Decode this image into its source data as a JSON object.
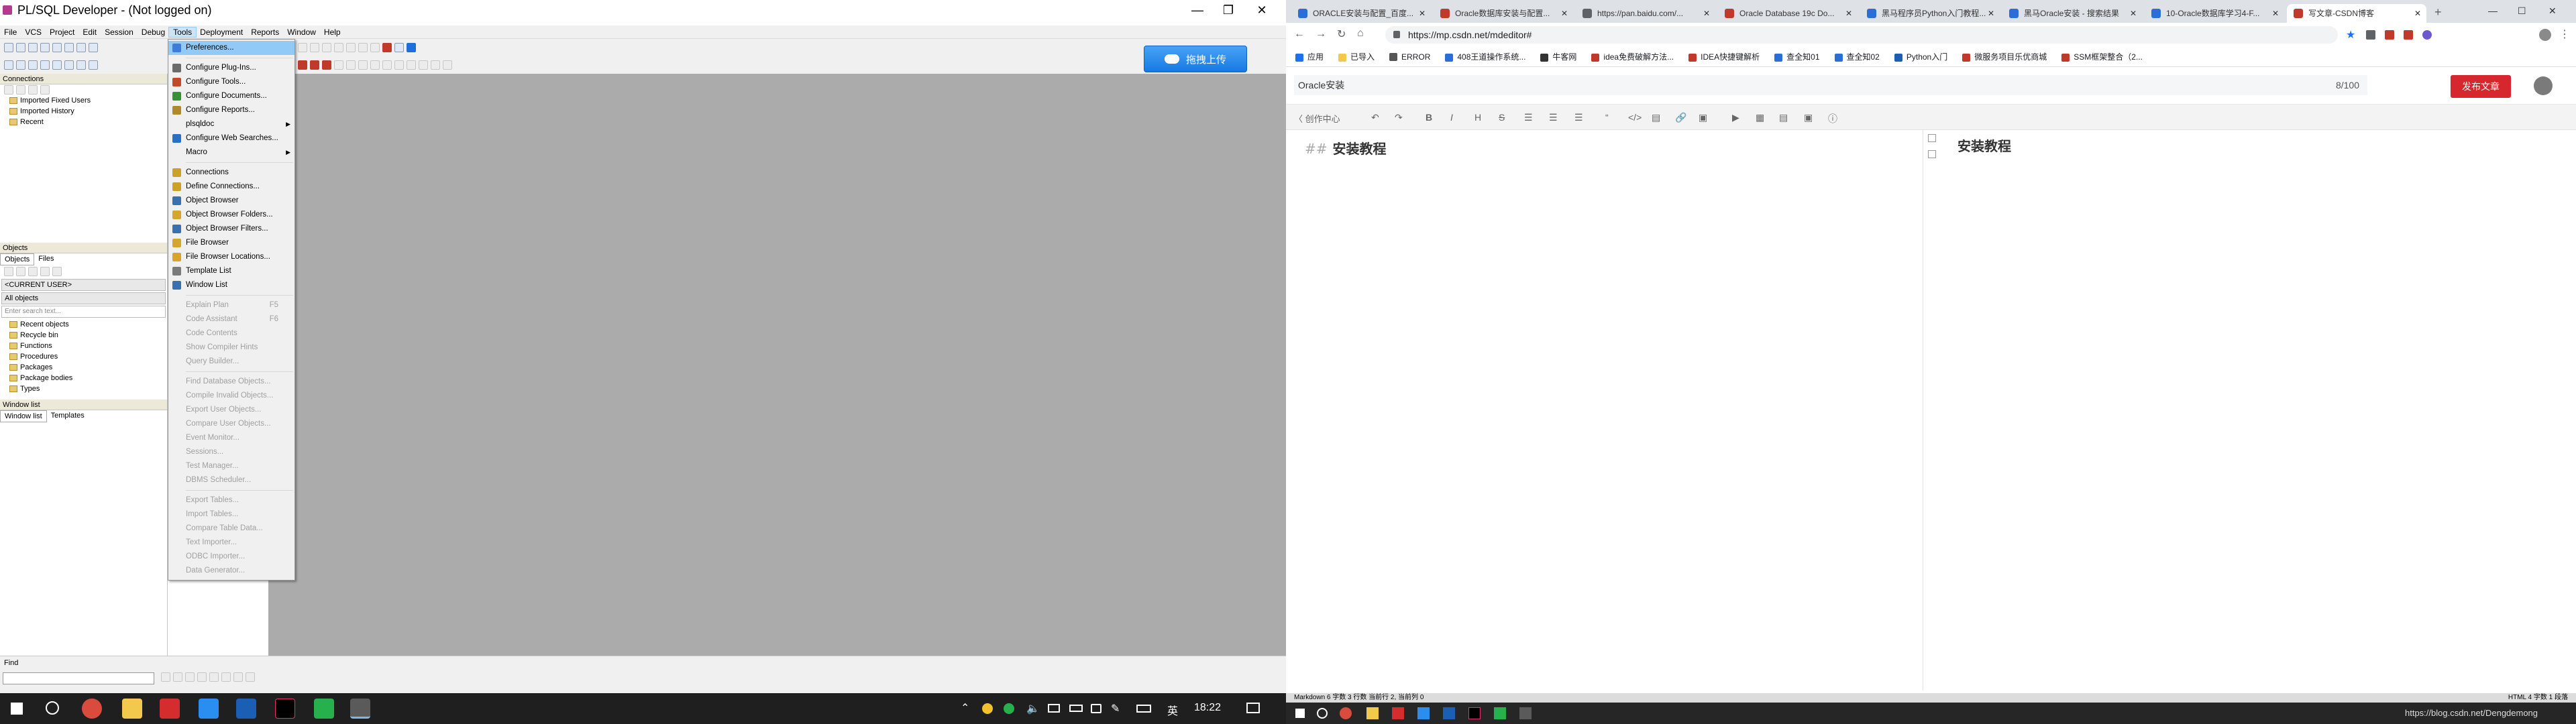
{
  "plsql": {
    "title": "PL/SQL Developer - (Not logged on)",
    "menus": [
      "File",
      "VCS",
      "Project",
      "Edit",
      "Session",
      "Debug",
      "Tools",
      "Deployment",
      "Reports",
      "Window",
      "Help"
    ],
    "upload_label": "拖拽上传",
    "connections_label": "Connections",
    "connections_items": [
      "Imported Fixed Users",
      "Imported History",
      "Recent"
    ],
    "objects_label": "Objects",
    "objects_tabs": [
      "Objects",
      "Files"
    ],
    "current_user": "<CURRENT USER>",
    "all_objects": "All objects",
    "search_placeholder": "Enter search text...",
    "object_tree": [
      "Recent objects",
      "Recycle bin",
      "Functions",
      "Procedures",
      "Packages",
      "Package bodies",
      "Types"
    ],
    "window_list_label": "Window list",
    "window_list_tabs": [
      "Window list",
      "Templates"
    ],
    "find_label": "Find"
  },
  "tools_menu": [
    {
      "label": "Preferences...",
      "state": "selected",
      "icon": "#3b7dd8"
    },
    {
      "sep": true
    },
    {
      "label": "Configure Plug-Ins...",
      "icon": "#6a6a6a"
    },
    {
      "label": "Configure Tools...",
      "icon": "#c24a2a"
    },
    {
      "label": "Configure Documents...",
      "icon": "#3a8f3a"
    },
    {
      "label": "Configure Reports...",
      "icon": "#b08a2a"
    },
    {
      "label": "plsqldoc",
      "arrow": true
    },
    {
      "label": "Configure Web Searches...",
      "icon": "#2a6fc2"
    },
    {
      "label": "Macro",
      "arrow": true
    },
    {
      "sep": true
    },
    {
      "label": "Connections",
      "icon": "#c9a227"
    },
    {
      "label": "Define Connections...",
      "icon": "#c9a227"
    },
    {
      "label": "Object Browser",
      "icon": "#3a6fb0"
    },
    {
      "label": "Object Browser Folders...",
      "icon": "#d4a72c"
    },
    {
      "label": "Object Browser Filters...",
      "icon": "#3a6fb0"
    },
    {
      "label": "File Browser",
      "icon": "#d4a72c"
    },
    {
      "label": "File Browser Locations...",
      "icon": "#d4a72c"
    },
    {
      "label": "Template List",
      "icon": "#7a7a7a"
    },
    {
      "label": "Window List",
      "icon": "#3a6fb0"
    },
    {
      "sep": true
    },
    {
      "label": "Explain Plan",
      "state": "disabled",
      "shortcut": "F5"
    },
    {
      "label": "Code Assistant",
      "state": "disabled",
      "shortcut": "F6"
    },
    {
      "label": "Code Contents",
      "state": "disabled"
    },
    {
      "label": "Show Compiler Hints",
      "state": "disabled"
    },
    {
      "label": "Query Builder...",
      "state": "disabled"
    },
    {
      "sep": true
    },
    {
      "label": "Find Database Objects...",
      "state": "disabled"
    },
    {
      "label": "Compile Invalid Objects...",
      "state": "disabled"
    },
    {
      "label": "Export User Objects...",
      "state": "disabled"
    },
    {
      "label": "Compare User Objects...",
      "state": "disabled"
    },
    {
      "label": "Event Monitor...",
      "state": "disabled"
    },
    {
      "label": "Sessions...",
      "state": "disabled"
    },
    {
      "label": "Test Manager...",
      "state": "disabled"
    },
    {
      "label": "DBMS Scheduler...",
      "state": "disabled"
    },
    {
      "sep": true
    },
    {
      "label": "Export Tables...",
      "state": "disabled"
    },
    {
      "label": "Import Tables...",
      "state": "disabled"
    },
    {
      "label": "Compare Table Data...",
      "state": "disabled"
    },
    {
      "label": "Text Importer...",
      "state": "disabled"
    },
    {
      "label": "ODBC Importer...",
      "state": "disabled"
    },
    {
      "label": "Data Generator...",
      "state": "disabled"
    }
  ],
  "chrome": {
    "tabs": [
      {
        "title": "ORACLE安装与配置_百度...",
        "color": "#2a6fd8"
      },
      {
        "title": "Oracle数据库安装与配置...",
        "color": "#c0392b"
      },
      {
        "title": "https://pan.baidu.com/...",
        "color": "#5f6368"
      },
      {
        "title": "Oracle Database 19c Do...",
        "color": "#c0392b"
      },
      {
        "title": "黑马程序员Python入门教程...",
        "color": "#2a6fd8"
      },
      {
        "title": "黑马Oracle安装 - 搜索结果",
        "color": "#2a6fd8"
      },
      {
        "title": "10-Oracle数据库学习4-F...",
        "color": "#2a6fd8"
      },
      {
        "title": "写文章-CSDN博客",
        "color": "#c0392b",
        "active": true
      }
    ],
    "url": "https://mp.csdn.net/mdeditor#",
    "bookmarks": [
      "应用",
      "已导入",
      "ERROR",
      "408王道操作系统...",
      "牛客网",
      "idea免费破解方法...",
      "IDEA快捷键解析",
      "查全知01",
      "查全知02",
      "Python入门",
      "微服务项目乐优商城",
      "SSM框架整合（2..."
    ]
  },
  "csdn": {
    "title_input": "Oracle安装",
    "title_count": "8/100",
    "publish_label": "发布文章",
    "center_label": "〈 创作中心",
    "editor_text": "## 安装教程",
    "editor_prefix": "##",
    "editor_heading": "安装教程",
    "preview_heading": "安装教程",
    "status_left": "Markdown  6 字数  3 行数  当前行 2, 当前列 0",
    "status_right": "HTML  4 字数  1 段落"
  },
  "taskbar": {
    "ime": "英",
    "time": "18:22",
    "watermark": "https://blog.csdn.net/Dengdemong"
  }
}
